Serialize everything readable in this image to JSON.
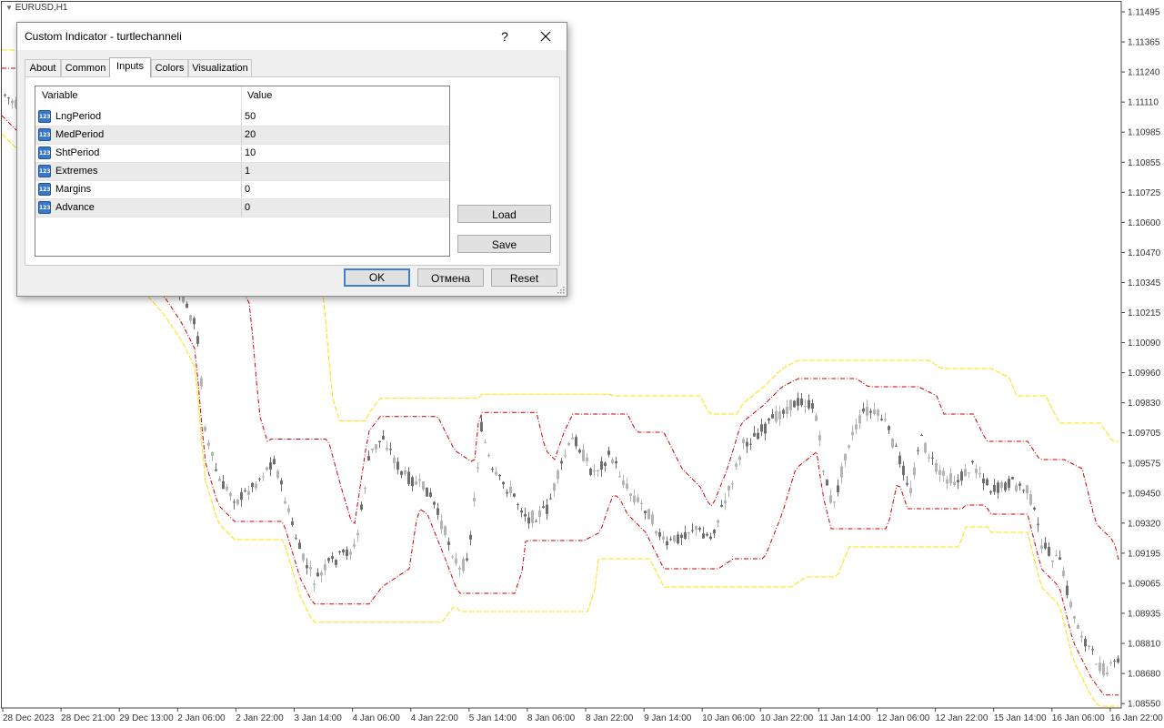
{
  "chart": {
    "symbol_label": "EURUSD,H1",
    "price_ticks": [
      "1.11495",
      "1.11365",
      "1.11240",
      "1.11110",
      "1.10985",
      "1.10855",
      "1.10725",
      "1.10600",
      "1.10470",
      "1.10345",
      "1.10215",
      "1.10090",
      "1.09960",
      "1.09830",
      "1.09705",
      "1.09575",
      "1.09450",
      "1.09320",
      "1.09195",
      "1.09065",
      "1.08935",
      "1.08810",
      "1.08680",
      "1.08550"
    ],
    "time_ticks": [
      "28 Dec 2023",
      "28 Dec 21:00",
      "29 Dec 13:00",
      "2 Jan 06:00",
      "2 Jan 22:00",
      "3 Jan 14:00",
      "4 Jan 06:00",
      "4 Jan 22:00",
      "5 Jan 14:00",
      "8 Jan 06:00",
      "8 Jan 22:00",
      "9 Jan 14:00",
      "10 Jan 06:00",
      "10 Jan 22:00",
      "11 Jan 14:00",
      "12 Jan 06:00",
      "12 Jan 22:00",
      "15 Jan 14:00",
      "16 Jan 06:00",
      "16 Jan 22:00"
    ],
    "colors": {
      "candle_up": "#b4b4b4",
      "candle_down": "#6e6e6e",
      "channel_red": "#cc0000",
      "channel_yellow": "#ffe000",
      "grid": "#c0c0c0"
    }
  },
  "dialog": {
    "title": "Custom Indicator - turtlechanneli",
    "help_label": "?",
    "tabs": [
      {
        "label": "About"
      },
      {
        "label": "Common"
      },
      {
        "label": "Inputs"
      },
      {
        "label": "Colors"
      },
      {
        "label": "Visualization"
      }
    ],
    "active_tab": "Inputs",
    "grid": {
      "headers": {
        "variable": "Variable",
        "value": "Value"
      },
      "icon_text": "123",
      "rows": [
        {
          "name": "LngPeriod",
          "value": "50"
        },
        {
          "name": "MedPeriod",
          "value": "20"
        },
        {
          "name": "ShtPeriod",
          "value": "10"
        },
        {
          "name": "Extremes",
          "value": "1"
        },
        {
          "name": "Margins",
          "value": "0"
        },
        {
          "name": "Advance",
          "value": "0"
        }
      ]
    },
    "buttons": {
      "load": "Load",
      "save": "Save",
      "ok": "OK",
      "cancel": "Отмена",
      "reset": "Reset"
    }
  }
}
